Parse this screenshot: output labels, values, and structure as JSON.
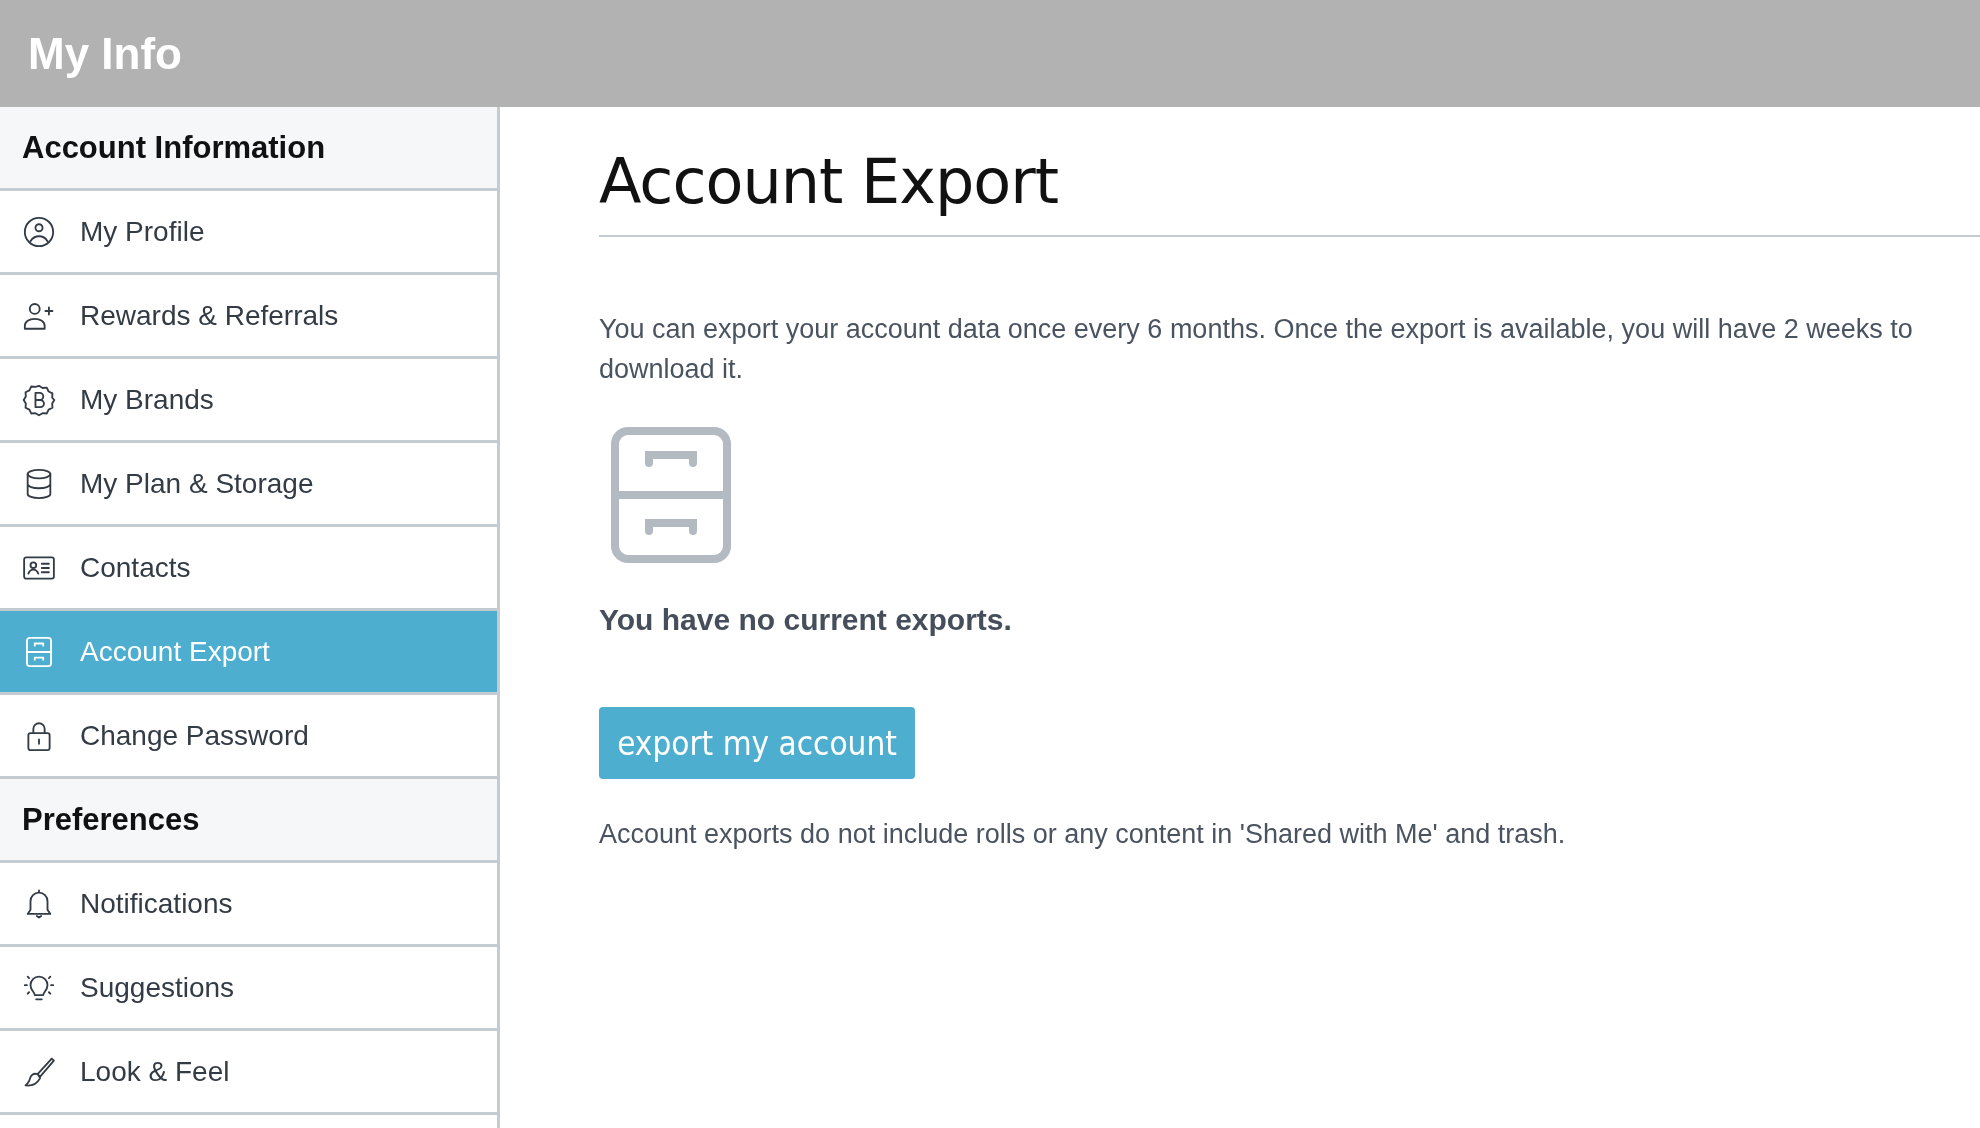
{
  "header": {
    "title": "My Info"
  },
  "sidebar": {
    "sections": [
      {
        "title": "Account Information",
        "items": [
          {
            "label": "My Profile",
            "selected": false
          },
          {
            "label": "Rewards & Referrals",
            "selected": false
          },
          {
            "label": "My Brands",
            "selected": false
          },
          {
            "label": "My Plan & Storage",
            "selected": false
          },
          {
            "label": "Contacts",
            "selected": false
          },
          {
            "label": "Account Export",
            "selected": true
          },
          {
            "label": "Change Password",
            "selected": false
          }
        ]
      },
      {
        "title": "Preferences",
        "items": [
          {
            "label": "Notifications",
            "selected": false
          },
          {
            "label": "Suggestions",
            "selected": false
          },
          {
            "label": "Look & Feel",
            "selected": false
          }
        ]
      }
    ]
  },
  "main": {
    "title": "Account Export",
    "description": "You can export your account data once every 6 months. Once the export is available, you will have 2 weeks to download it.",
    "empty_message": "You have no current exports.",
    "button": "export my account",
    "note": "Account exports do not include rolls or any content in 'Shared with Me' and trash."
  }
}
